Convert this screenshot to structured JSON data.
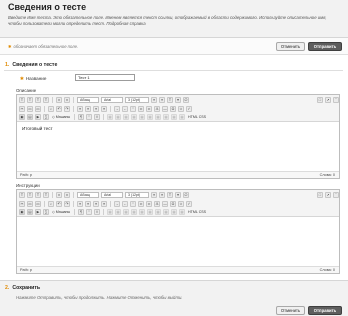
{
  "header": {
    "title": "Сведения о тесте",
    "intro": "Введите Имя теста. Это обязательное поле. Именем является текст ссылки, отображаемый в области содержимого. Используйте описательное имя, чтобы пользователи могли определить тест. Подробная справка"
  },
  "required_note": "обозначает обязательное поле.",
  "buttons": {
    "cancel": "Отменить",
    "submit": "Отправить"
  },
  "section1": {
    "number": "1.",
    "title": "Сведения о тесте",
    "name_label": "Название",
    "name_value": "Тест 1",
    "description_label": "Описание",
    "instructions_label": "Инструкции"
  },
  "editor_toolbar": {
    "paragraph": "Абзац",
    "font": "Arial",
    "size": "3 (12pt)",
    "mashups": "Мэшапы",
    "html": "HTML CSS"
  },
  "editor1": {
    "content": "Итоговый тест",
    "path_label": "Path: p",
    "words_label": "Слова: 0"
  },
  "editor2": {
    "content": "",
    "path_label": "Path: p",
    "words_label": "Слова: 0"
  },
  "section2": {
    "number": "2.",
    "title": "Сохранить",
    "instruction": "Нажмите Отправить, чтобы продолжить. Нажмите Отменить, чтобы выйти."
  }
}
